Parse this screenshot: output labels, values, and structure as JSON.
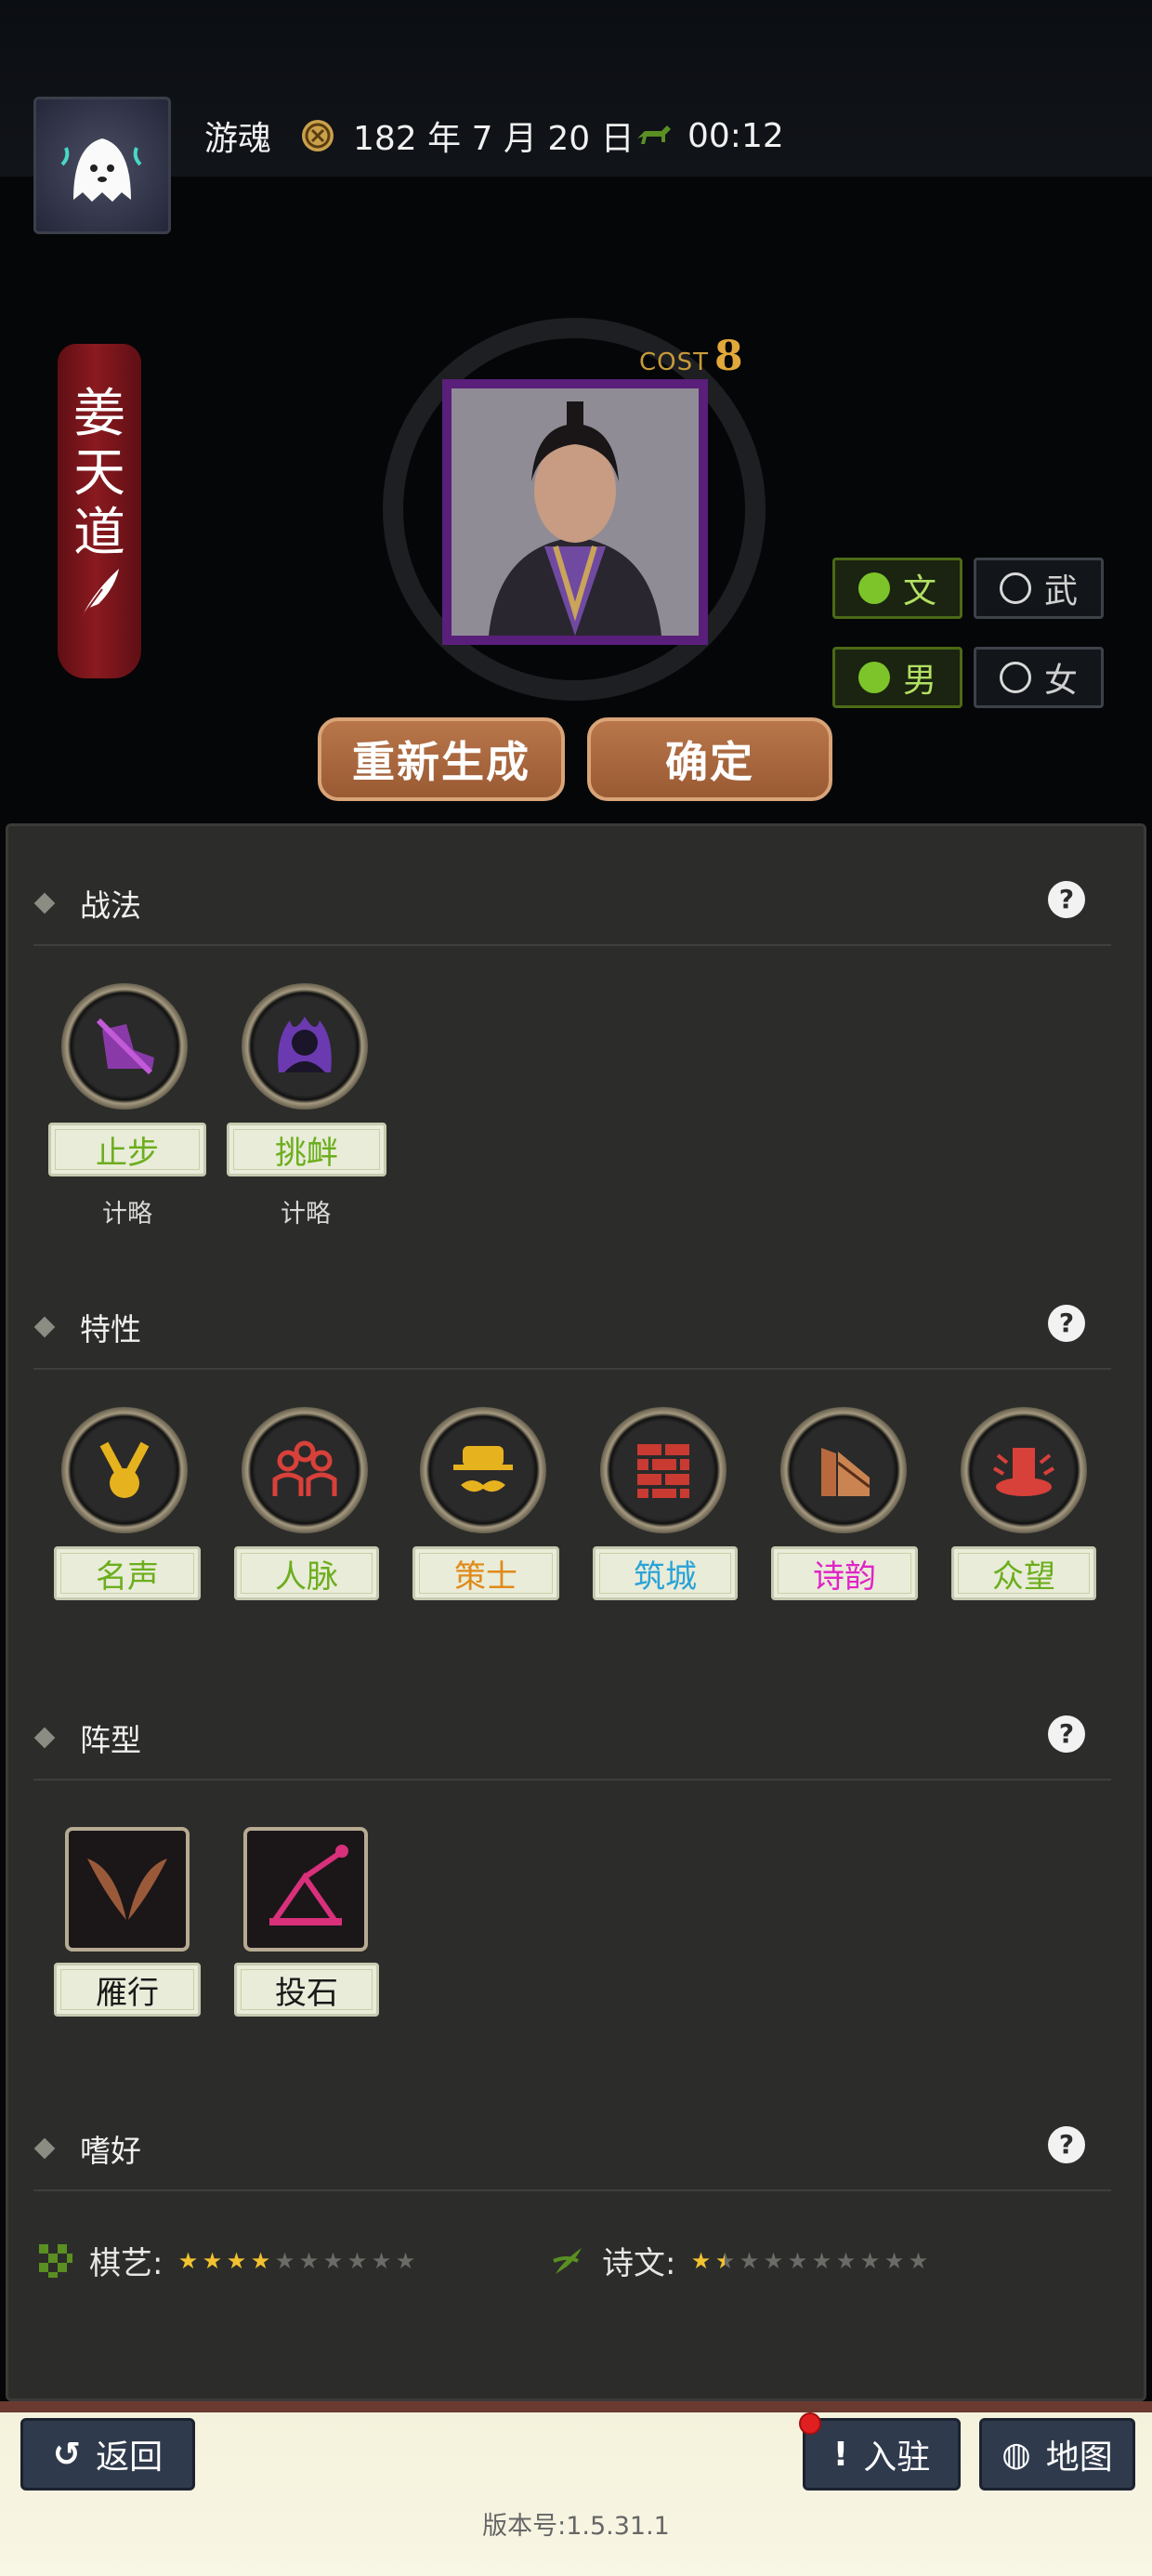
{
  "header": {
    "player_name": "游魂",
    "date": "182 年 7 月 20 日",
    "time": "00:12",
    "icons": [
      "ghost-avatar-icon",
      "calendar-seal-icon",
      "horse-icon"
    ]
  },
  "hero": {
    "name_chars": [
      "姜",
      "天",
      "道"
    ],
    "cost_label": "COST",
    "cost_value": "8",
    "options": {
      "civil": "文",
      "military": "武",
      "male": "男",
      "female": "女"
    },
    "selected": [
      "文",
      "男"
    ],
    "regenerate_label": "重新生成",
    "confirm_label": "确定"
  },
  "sections": {
    "tactics": {
      "title": "战法",
      "items": [
        {
          "name": "止步",
          "type": "计略",
          "icon": "boot-icon"
        },
        {
          "name": "挑衅",
          "type": "计略",
          "icon": "flame-figure-icon"
        }
      ]
    },
    "traits": {
      "title": "特性",
      "items": [
        {
          "name": "名声",
          "color": "#6cae1e",
          "icon": "medal-icon"
        },
        {
          "name": "人脉",
          "color": "#6cae1e",
          "icon": "people-icon"
        },
        {
          "name": "策士",
          "color": "#e08a1a",
          "icon": "strategist-icon"
        },
        {
          "name": "筑城",
          "color": "#2aa3d8",
          "icon": "brick-wall-icon"
        },
        {
          "name": "诗韵",
          "color": "#e024c6",
          "icon": "scroll-icon"
        },
        {
          "name": "众望",
          "color": "#6cae1e",
          "icon": "podium-icon"
        }
      ]
    },
    "formation": {
      "title": "阵型",
      "items": [
        {
          "name": "雁行",
          "icon": "wings-icon"
        },
        {
          "name": "投石",
          "icon": "catapult-icon"
        }
      ]
    },
    "hobbies": {
      "title": "嗜好",
      "items": [
        {
          "name": "棋艺:",
          "rating": 4,
          "max": 10,
          "icon": "chess-board-icon"
        },
        {
          "name": "诗文:",
          "rating": 1.5,
          "max": 10,
          "icon": "brush-icon"
        }
      ]
    }
  },
  "footer": {
    "back_label": "返回",
    "station_label": "入驻",
    "map_label": "地图",
    "version": "版本号:1.5.31.1"
  },
  "colors": {
    "accent_green": "#7dc32a",
    "panel_bg": "#2c2d2a",
    "button_brown": "#a9683f",
    "nav_blue": "#2f3a4c"
  }
}
